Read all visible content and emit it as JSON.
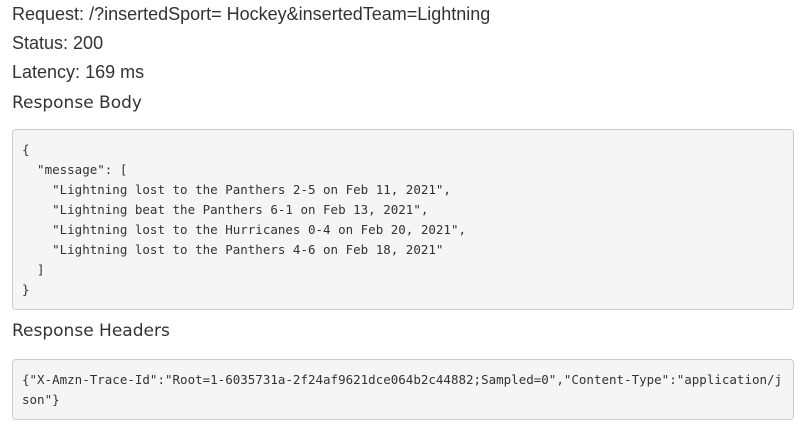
{
  "request": {
    "label": "Request:",
    "value": "/?insertedSport= Hockey&insertedTeam=Lightning"
  },
  "status": {
    "label": "Status:",
    "value": "200"
  },
  "latency": {
    "label": "Latency:",
    "value": "169 ms"
  },
  "response_body": {
    "title": "Response Body",
    "content": "{\n  \"message\": [\n    \"Lightning lost to the Panthers 2-5 on Feb 11, 2021\",\n    \"Lightning beat the Panthers 6-1 on Feb 13, 2021\",\n    \"Lightning lost to the Hurricanes 0-4 on Feb 20, 2021\",\n    \"Lightning lost to the Panthers 4-6 on Feb 18, 2021\"\n  ]\n}"
  },
  "response_headers": {
    "title": "Response Headers",
    "content": "{\"X-Amzn-Trace-Id\":\"Root=1-6035731a-2f24af9621dce064b2c44882;Sampled=0\",\"Content-Type\":\"application/json\"}"
  }
}
